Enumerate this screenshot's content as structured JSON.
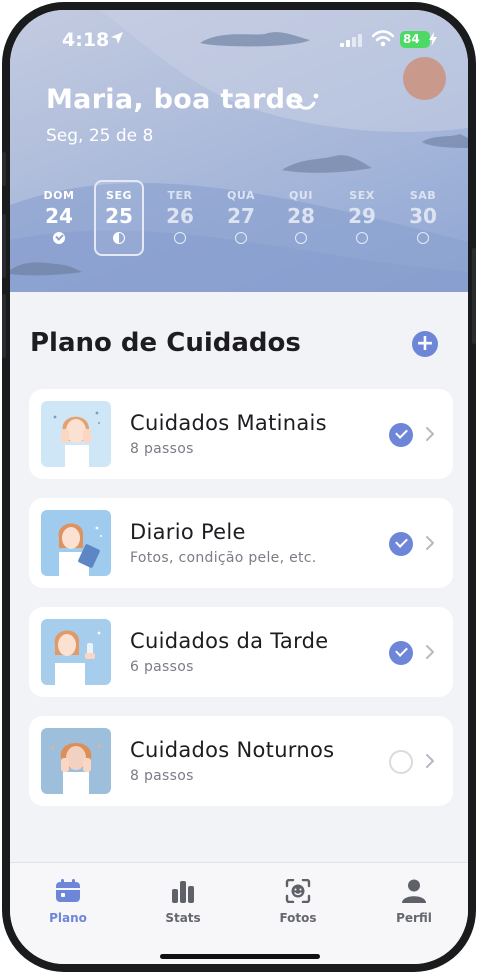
{
  "status_bar": {
    "time": "4:18",
    "battery": "84"
  },
  "header": {
    "greeting": "Maria, boa tarde",
    "date": "Seg, 25 de 8",
    "week": [
      {
        "name": "DOM",
        "num": "24",
        "state": "done"
      },
      {
        "name": "SEG",
        "num": "25",
        "state": "selected"
      },
      {
        "name": "TER",
        "num": "26",
        "state": "muted"
      },
      {
        "name": "QUA",
        "num": "27",
        "state": "muted"
      },
      {
        "name": "QUI",
        "num": "28",
        "state": "muted"
      },
      {
        "name": "SEX",
        "num": "29",
        "state": "muted"
      },
      {
        "name": "SAB",
        "num": "30",
        "state": "muted"
      }
    ]
  },
  "main": {
    "section_title": "Plano de Cuidados",
    "add_label": "+",
    "routines": [
      {
        "title": "Cuidados Matinais",
        "subtitle": "8 passos",
        "checked": true
      },
      {
        "title": "Diario Pele",
        "subtitle": "Fotos, condição pele, etc.",
        "checked": true
      },
      {
        "title": "Cuidados da Tarde",
        "subtitle": "6 passos",
        "checked": true
      },
      {
        "title": "Cuidados Noturnos",
        "subtitle": "8 passos",
        "checked": false
      }
    ]
  },
  "tabbar": {
    "tabs": [
      {
        "label": "Plano",
        "icon": "calendar-icon",
        "active": true
      },
      {
        "label": "Stats",
        "icon": "bar-chart-icon",
        "active": false
      },
      {
        "label": "Fotos",
        "icon": "face-scan-icon",
        "active": false
      },
      {
        "label": "Perfil",
        "icon": "person-icon",
        "active": false
      }
    ]
  },
  "colors": {
    "accent": "#6d86d8",
    "header_top": "#c3cbe0",
    "header_bottom": "#8fa5d2",
    "background": "#f2f3f7",
    "battery": "#4cd964",
    "avatar": "#c99a8c"
  }
}
